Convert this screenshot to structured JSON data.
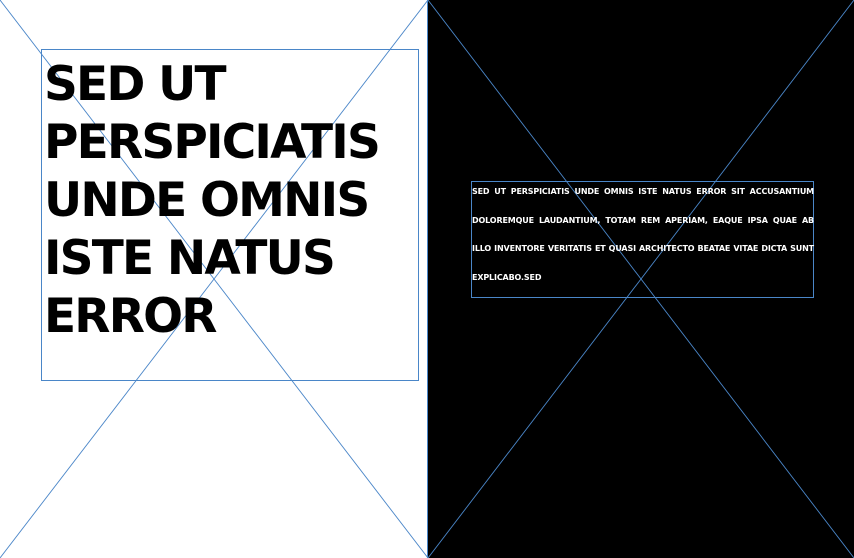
{
  "left_panel": {
    "headline": "SED UT PERSPICIATIS UNDE OMNIS ISTE NATUS ERROR"
  },
  "right_panel": {
    "body_text": "SED UT PERSPICIATIS UNDE OMNIS ISTE NATUS ERROR SIT ACCUSANTIUM DOLOREMQUE LAUDANTIUM, TOTAM REM APERIAM, EAQUE IPSA QUAE AB ILLO INVENTORE VERITATIS ET QUASI ARCHITECTO BEATAE VITAE DICTA SUNT EXPLICABO.SED"
  },
  "colors": {
    "left_background": "#ffffff",
    "right_background": "#000000",
    "guide_stroke": "#4a86c8",
    "headline_text": "#000000",
    "body_text": "#ffffff"
  }
}
